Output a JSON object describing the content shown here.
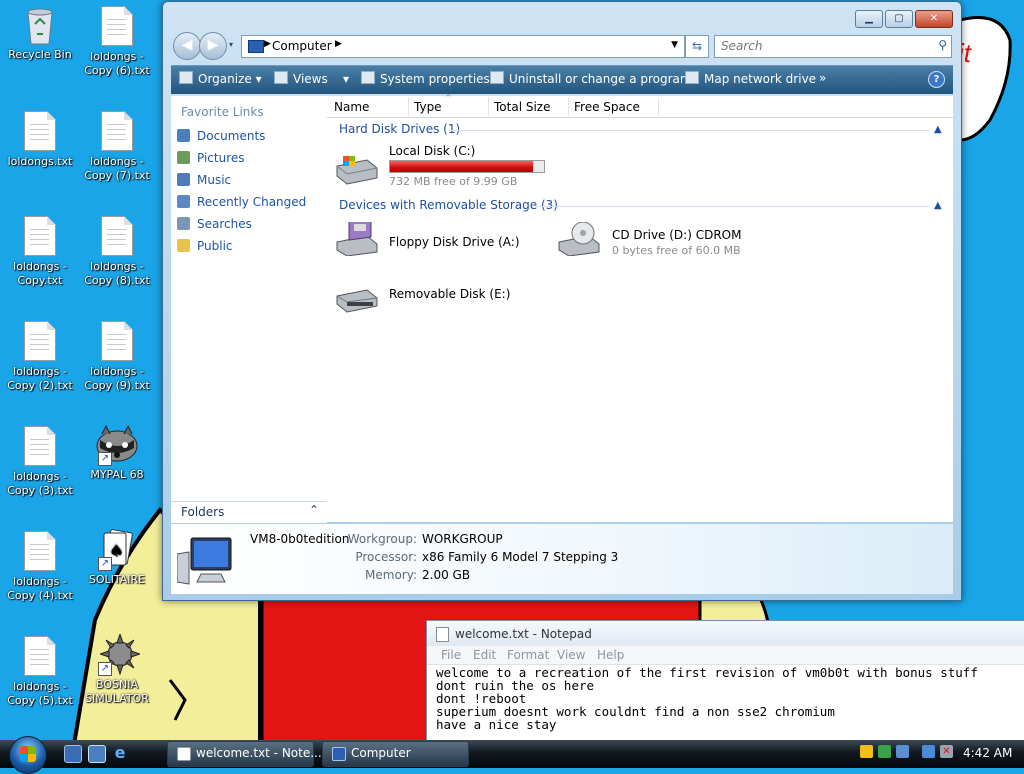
{
  "desktop": {
    "icons": [
      {
        "label": "Recycle Bin"
      },
      {
        "label": "loldongs - Copy (6).txt"
      },
      {
        "label": "loldongs.txt"
      },
      {
        "label": "loldongs - Copy (7).txt"
      },
      {
        "label": "loldongs - Copy.txt"
      },
      {
        "label": "loldongs - Copy (8).txt"
      },
      {
        "label": "loldongs - Copy (2).txt"
      },
      {
        "label": "loldongs - Copy (9).txt"
      },
      {
        "label": "loldongs - Copy (3).txt"
      },
      {
        "label": "MYPAL 68"
      },
      {
        "label": "loldongs - Copy (4).txt"
      },
      {
        "label": "SOLITAIRE"
      },
      {
        "label": "loldongs - Copy (5).txt"
      },
      {
        "label": "BOSNIA SIMULATOR"
      }
    ]
  },
  "explorer": {
    "breadcrumb": "Computer",
    "search_placeholder": "Search",
    "toolbar": {
      "organize": "Organize",
      "views": "Views",
      "system_properties": "System properties",
      "uninstall": "Uninstall or change a program",
      "map_drive": "Map network drive",
      "more": "»",
      "help": "?"
    },
    "nav": {
      "header": "Favorite Links",
      "links": [
        {
          "label": "Documents"
        },
        {
          "label": "Pictures"
        },
        {
          "label": "Music"
        },
        {
          "label": "Recently Changed"
        },
        {
          "label": "Searches"
        },
        {
          "label": "Public"
        }
      ],
      "folders": "Folders"
    },
    "columns": [
      "Name",
      "Type",
      "Total Size",
      "Free Space"
    ],
    "groups": {
      "hdd": {
        "title": "Hard Disk Drives (1)",
        "drives": [
          {
            "name": "Local Disk (C:)",
            "sub": "732 MB free of 9.99 GB",
            "used_fraction": 0.93
          }
        ]
      },
      "removable": {
        "title": "Devices with Removable Storage (3)",
        "drives": [
          {
            "name": "Floppy Disk Drive (A:)"
          },
          {
            "name": "CD Drive (D:) CDROM",
            "sub": "0 bytes free of 60.0 MB"
          },
          {
            "name": "Removable Disk (E:)"
          }
        ]
      }
    },
    "details": {
      "computer_name": "VM8-0b0tedition",
      "workgroup_label": "Workgroup:",
      "workgroup": "WORKGROUP",
      "processor_label": "Processor:",
      "processor": "x86 Family 6 Model 7 Stepping 3",
      "memory_label": "Memory:",
      "memory": "2.00 GB"
    }
  },
  "notepad": {
    "title": "welcome.txt - Notepad",
    "menu": [
      "File",
      "Edit",
      "Format",
      "View",
      "Help"
    ],
    "text": "welcome to a recreation of the first revision of vm0b0t with bonus stuff\ndont ruin the os here\ndont !reboot\nsuperium doesnt work couldnt find a non sse2 chromium\nhave a nice stay"
  },
  "taskbar": {
    "buttons": [
      {
        "label": "welcome.txt - Note..."
      },
      {
        "label": "Computer"
      }
    ],
    "clock": "4:42 AM"
  },
  "wallpaper_fragment": "it"
}
